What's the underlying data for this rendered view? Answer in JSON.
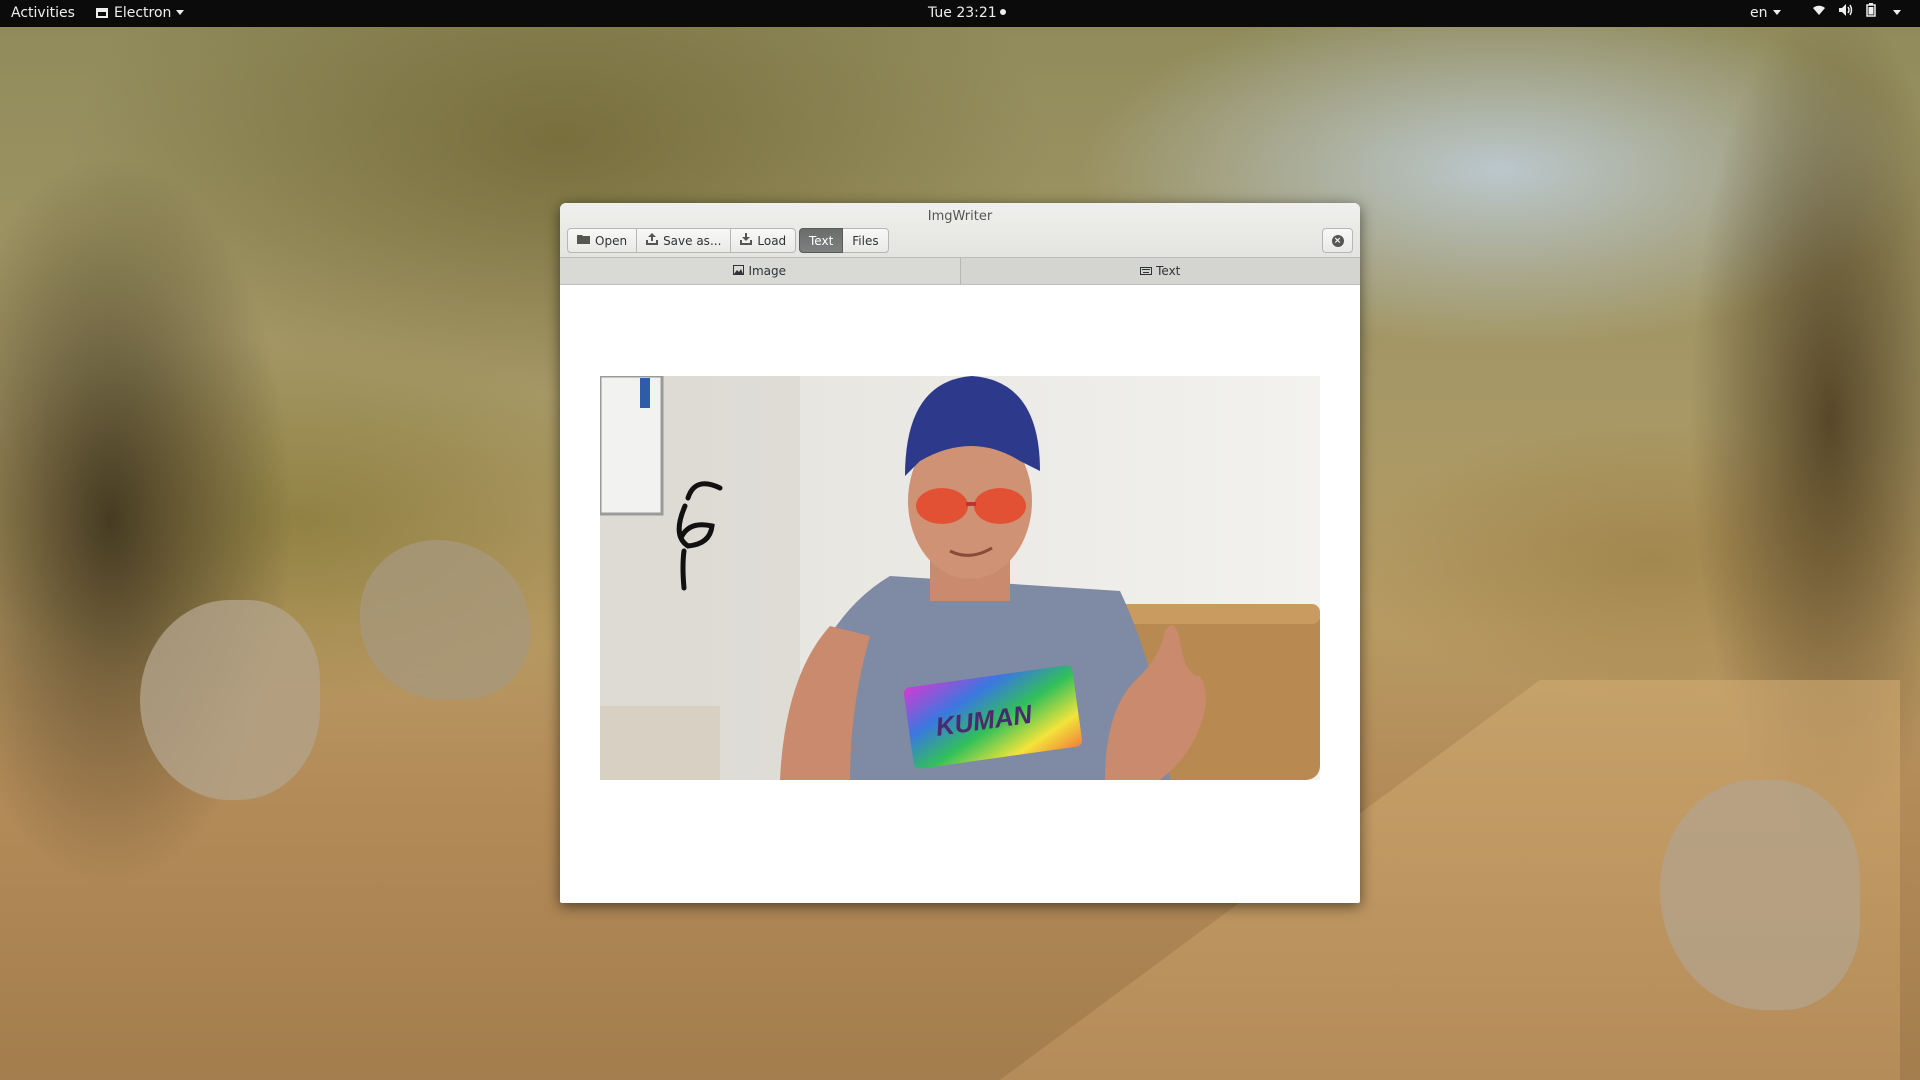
{
  "topbar": {
    "activities": "Activities",
    "app_menu": "Electron",
    "clock": "Tue 23:21",
    "language": "en",
    "tray_icons": [
      "wifi-icon",
      "volume-icon",
      "battery-icon"
    ]
  },
  "window": {
    "title": "ImgWriter",
    "toolbar": {
      "open_label": "Open",
      "save_as_label": "Save as...",
      "load_label": "Load",
      "mode_text_label": "Text",
      "mode_files_label": "Files",
      "active_mode": "Text"
    },
    "tabs": [
      {
        "label": "Image",
        "icon": "image-icon"
      },
      {
        "label": "Text",
        "icon": "keyboard-icon"
      }
    ],
    "photo": {
      "shirt_text": "KUMAN"
    }
  },
  "colors": {
    "topbar_bg": "#0b0b0b",
    "active_toggle": "#6a6d6b",
    "window_bg": "#ffffff"
  }
}
